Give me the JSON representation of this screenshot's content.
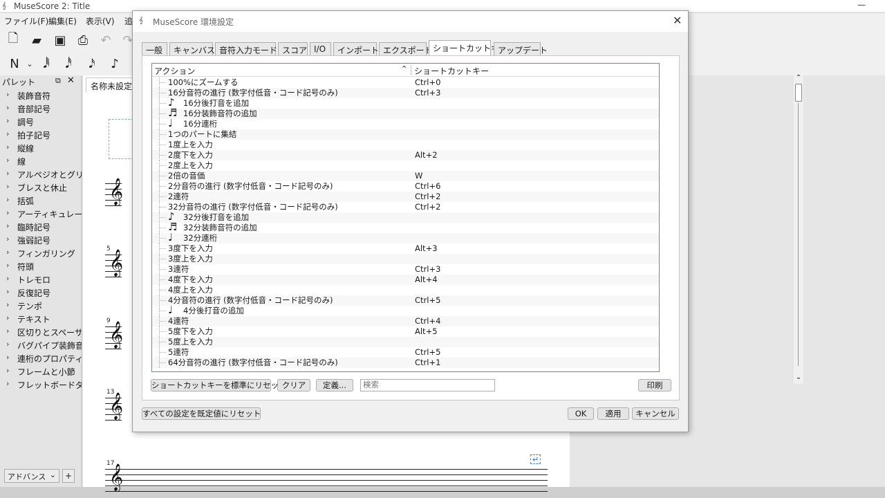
{
  "window": {
    "title": "MuseScore 2: Title"
  },
  "menu": [
    "ファイル(F)",
    "編集(E)",
    "表示(V)",
    "追"
  ],
  "palette": {
    "title": "パレット",
    "items": [
      "装飾音符",
      "音部記号",
      "調号",
      "拍子記号",
      "縦線",
      "線",
      "アルペジオとグリッサ",
      "ブレスと休止",
      "括弧",
      "アーティキュレーショ",
      "臨時記号",
      "強弱記号",
      "フィンガリング",
      "符頭",
      "トレモロ",
      "反復記号",
      "テンポ",
      "テキスト",
      "区切りとスペーサー",
      "バグパイプ装飾音",
      "連桁のプロパティ",
      "フレームと小節",
      "フレットボードダイア"
    ],
    "mode": "アドバンス",
    "add": "+"
  },
  "score": {
    "tab": "名称未設定",
    "measure_numbers": [
      "5",
      "9",
      "13",
      "17"
    ]
  },
  "dialog": {
    "title": "MuseScore 環境設定",
    "tabs": [
      "一般",
      "キャンバス",
      "音符入力モード",
      "スコア",
      "I/O",
      "インポート",
      "エクスポート",
      "ショートカットキー",
      "アップデート"
    ],
    "active_tab": "ショートカットキー",
    "columns": {
      "action": "アクション",
      "shortcut": "ショートカットキー"
    },
    "rows": [
      {
        "action": "100%にズームする",
        "shortcut": "Ctrl+0",
        "icon": ""
      },
      {
        "action": "16分音符の進行 (数字付低音・コード記号のみ)",
        "shortcut": "Ctrl+3",
        "icon": ""
      },
      {
        "action": "16分後打音を追加",
        "shortcut": "",
        "icon": "♪"
      },
      {
        "action": "16分装飾音符の追加",
        "shortcut": "",
        "icon": "♬"
      },
      {
        "action": "16分連桁",
        "shortcut": "",
        "icon": "♩"
      },
      {
        "action": "1つのパートに集結",
        "shortcut": "",
        "icon": ""
      },
      {
        "action": "1度上を入力",
        "shortcut": "",
        "icon": ""
      },
      {
        "action": "2度下を入力",
        "shortcut": "Alt+2",
        "icon": ""
      },
      {
        "action": "2度上を入力",
        "shortcut": "",
        "icon": ""
      },
      {
        "action": "2倍の音価",
        "shortcut": "W",
        "icon": ""
      },
      {
        "action": "2分音符の進行 (数字付低音・コード記号のみ)",
        "shortcut": "Ctrl+6",
        "icon": ""
      },
      {
        "action": "2連符",
        "shortcut": "Ctrl+2",
        "icon": ""
      },
      {
        "action": "32分音符の進行 (数字付低音・コード記号のみ)",
        "shortcut": "Ctrl+2",
        "icon": ""
      },
      {
        "action": "32分後打音を追加",
        "shortcut": "",
        "icon": "♪"
      },
      {
        "action": "32分装飾音符の追加",
        "shortcut": "",
        "icon": "♬"
      },
      {
        "action": "32分連桁",
        "shortcut": "",
        "icon": "♩"
      },
      {
        "action": "3度下を入力",
        "shortcut": "Alt+3",
        "icon": ""
      },
      {
        "action": "3度上を入力",
        "shortcut": "",
        "icon": ""
      },
      {
        "action": "3連符",
        "shortcut": "Ctrl+3",
        "icon": ""
      },
      {
        "action": "4度下を入力",
        "shortcut": "Alt+4",
        "icon": ""
      },
      {
        "action": "4度上を入力",
        "shortcut": "",
        "icon": ""
      },
      {
        "action": "4分音符の進行 (数字付低音・コード記号のみ)",
        "shortcut": "Ctrl+5",
        "icon": ""
      },
      {
        "action": "4分後打音の追加",
        "shortcut": "",
        "icon": "♩"
      },
      {
        "action": "4連符",
        "shortcut": "Ctrl+4",
        "icon": ""
      },
      {
        "action": "5度下を入力",
        "shortcut": "Alt+5",
        "icon": ""
      },
      {
        "action": "5度上を入力",
        "shortcut": "",
        "icon": ""
      },
      {
        "action": "5連符",
        "shortcut": "Ctrl+5",
        "icon": ""
      },
      {
        "action": "64分音符の進行 (数字付低音・コード記号のみ)",
        "shortcut": "Ctrl+1",
        "icon": ""
      }
    ],
    "buttons": {
      "reset_shortcuts": "ショートカットキーを標準にリセット",
      "clear": "クリア",
      "define": "定義...",
      "print": "印刷",
      "reset_all": "すべての設定を既定値にリセット",
      "ok": "OK",
      "apply": "適用",
      "cancel": "キャンセル"
    },
    "search_placeholder": "検索"
  }
}
